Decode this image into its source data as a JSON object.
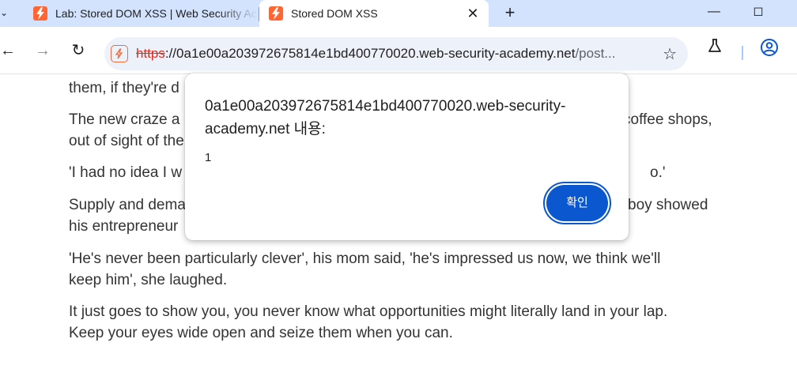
{
  "tabs": {
    "inactive_title": "Lab: Stored DOM XSS | Web Security Academy",
    "active_title": "Stored DOM XSS",
    "new_tab_glyph": "+"
  },
  "toolbar": {
    "url_scheme": "https",
    "url_host": "://0a1e00a203972675814e1bd400770020.web-security-academy.net",
    "url_path": "/post...",
    "icons": [
      "back-icon",
      "forward-icon",
      "reload-icon",
      "site-info-icon",
      "bookmark-star-icon",
      "labs-flask-icon",
      "profile-icon"
    ]
  },
  "page": {
    "paragraphs": [
      "them, if they're d",
      "The new craze a",
      "out of sight of the",
      "'I had no idea I w",
      "Supply and dema",
      "his entrepreneur",
      "'He's never been particularly clever', his mom said, 'he's impressed us now, we think we'll",
      "keep him', she laughed.",
      "It just goes to show you, you never know what opportunities might literally land in your lap.",
      "Keep your eyes wide open and seize them when you can."
    ],
    "right_fragments": [
      "coffee shops,",
      "o.'",
      "boy showed"
    ]
  },
  "dialog": {
    "origin_line1": "0a1e00a203972675814e1bd400770020.web-security-",
    "origin_line2": "academy.net 내용:",
    "message": "1",
    "ok_label": "확인"
  },
  "colors": {
    "tabstrip": "#d3e3fd",
    "favicon": "#ff6633",
    "accent": "#0b57d0",
    "insecure_scheme": "#d93025"
  }
}
